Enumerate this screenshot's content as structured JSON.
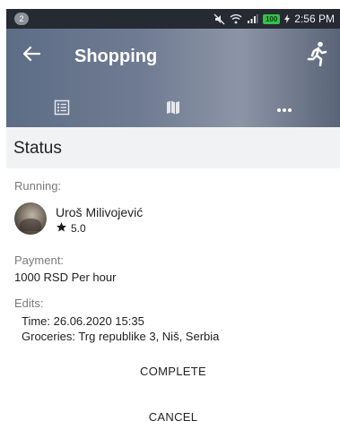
{
  "status_bar": {
    "notification_count": "2",
    "battery": "100",
    "time": "2:56 PM"
  },
  "app_bar": {
    "title": "Shopping",
    "back_icon": "arrow-left",
    "action_icon": "running-person",
    "tabs": [
      {
        "icon": "list-icon"
      },
      {
        "icon": "map-icon"
      },
      {
        "icon": "more-dots-icon"
      }
    ]
  },
  "section": {
    "title": "Status"
  },
  "running": {
    "label": "Running:",
    "name": "Uroš Milivojević",
    "rating": "5.0"
  },
  "payment": {
    "label": "Payment:",
    "value": "1000 RSD Per hour"
  },
  "edits": {
    "label": "Edits:",
    "time": "Time: 26.06.2020 15:35",
    "groceries": "Groceries: Trg republike 3, Niš, Serbia"
  },
  "actions": {
    "complete": "COMPLETE",
    "cancel": "CANCEL"
  },
  "colors": {
    "app_bar": "#6f7b92",
    "status_bar": "#262a33",
    "section_bg": "#f1f2f4"
  }
}
